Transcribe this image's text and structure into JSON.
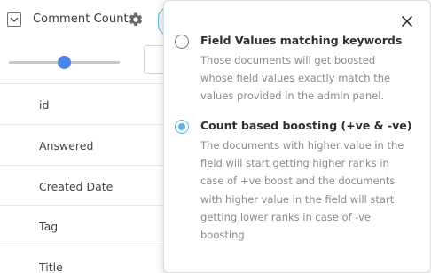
{
  "field": {
    "title": "Comment Count"
  },
  "slider": {
    "value_fraction": 0.5
  },
  "fields_list": [
    {
      "label": "id"
    },
    {
      "label": "Answered"
    },
    {
      "label": "Created Date"
    },
    {
      "label": "Tag"
    },
    {
      "label": "Title"
    }
  ],
  "popover": {
    "options": [
      {
        "title": "Field Values matching keywords",
        "desc_lines": [
          "Those documents will get boosted",
          "whose field values exactly match the",
          "values provided in the admin panel."
        ],
        "selected": false
      },
      {
        "title": "Count based boosting (+ve & -ve)",
        "desc_lines": [
          "The documents with higher value in the",
          "field will start getting higher ranks in",
          "case of +ve boost and the documents",
          "with higher value in the field will start",
          "getting lower ranks in case of -ve",
          "boosting"
        ],
        "selected": true
      }
    ]
  },
  "colors": {
    "accent": "#58b6e8",
    "slider_thumb": "#4a86e8"
  },
  "icons": [
    "chevron-down-icon",
    "gear-icon",
    "close-icon"
  ]
}
